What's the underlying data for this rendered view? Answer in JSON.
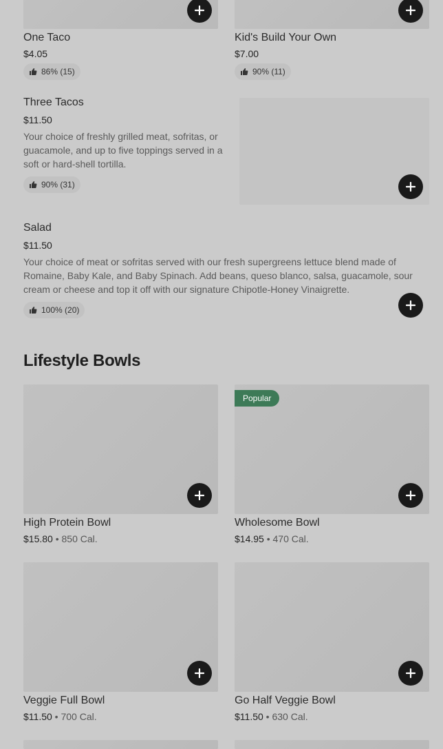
{
  "items_top": {
    "one_taco": {
      "title": "One Taco",
      "price": "$4.05",
      "rating": "86% (15)"
    },
    "kids_build": {
      "title": "Kid's Build Your Own",
      "price": "$7.00",
      "rating": "90% (11)"
    },
    "three_tacos": {
      "title": "Three Tacos",
      "price": "$11.50",
      "description": "Your choice of freshly grilled meat, sofritas, or guacamole, and up to five toppings served in a soft or hard-shell tortilla.",
      "rating": "90% (31)"
    },
    "salad": {
      "title": "Salad",
      "price": "$11.50",
      "description": "Your choice of meat or sofritas served with our fresh supergreens lettuce blend made of Romaine, Baby Kale, and Baby Spinach. Add beans, queso blanco, salsa, guacamole, sour cream or cheese and top it off with our signature Chipotle-Honey Vinaigrette.",
      "rating": "100% (20)"
    }
  },
  "lifestyle": {
    "section_title": "Lifestyle Bowls",
    "popular_badge": "Popular",
    "separator": "•",
    "bowls": [
      {
        "title": "High Protein Bowl",
        "price": "$15.80",
        "cal": "850 Cal."
      },
      {
        "title": "Wholesome Bowl",
        "price": "$14.95",
        "cal": "470 Cal."
      },
      {
        "title": "Veggie Full Bowl",
        "price": "$11.50",
        "cal": "700 Cal."
      },
      {
        "title": "Go Half Veggie Bowl",
        "price": "$11.50",
        "cal": "630 Cal."
      }
    ]
  },
  "icons": {
    "add": "plus-icon",
    "rating": "thumbs-up-icon"
  },
  "colors": {
    "add_button": "#1a1a1a",
    "popular_badge": "#3d7a57",
    "background": "#cbcbcb",
    "image_placeholder": "#bdbdbd"
  }
}
